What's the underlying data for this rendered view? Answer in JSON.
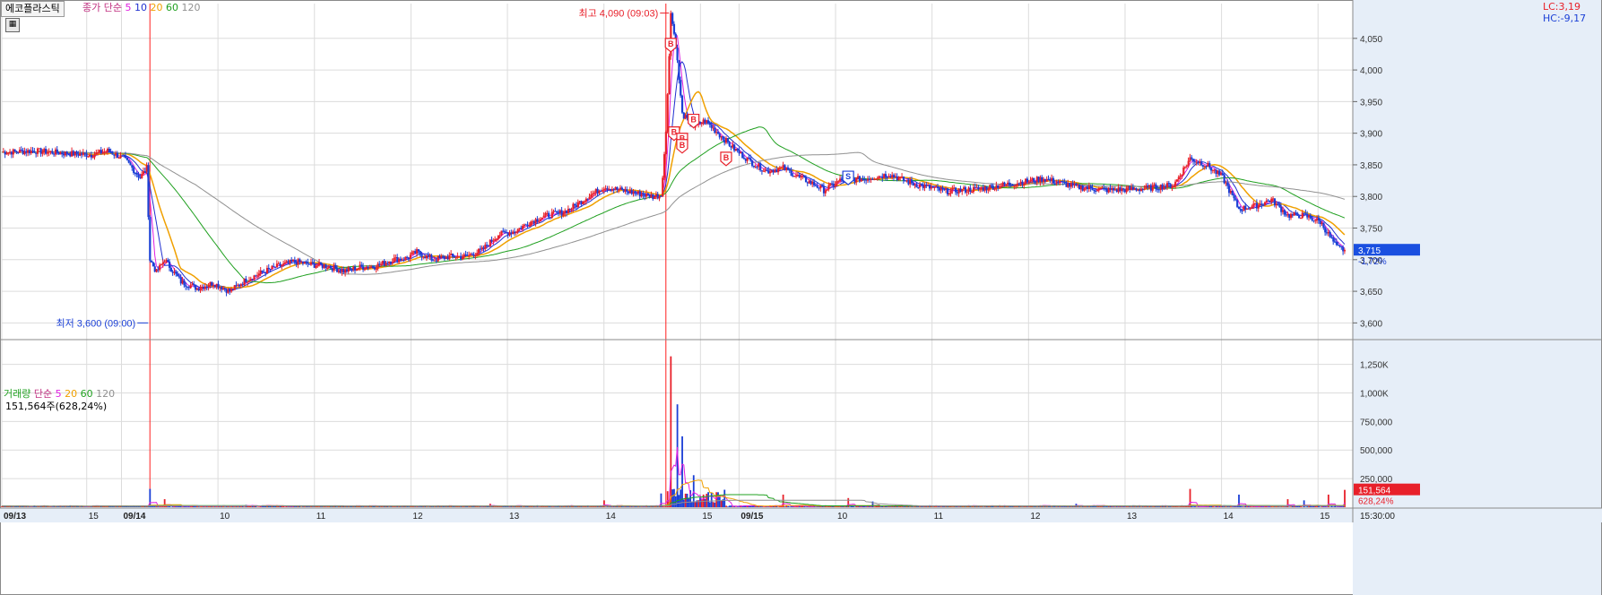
{
  "title": "에코플라스틱",
  "price_indicator": {
    "label": "종가",
    "ma_type": "단순",
    "periods": [
      "5",
      "10",
      "20",
      "60",
      "120"
    ]
  },
  "volume_indicator": {
    "label": "거래량",
    "ma_type": "단순",
    "periods": [
      "5",
      "20",
      "60",
      "120"
    ],
    "current": "151,564주(628,24%)"
  },
  "corner": {
    "lc": "LC:3,19",
    "hc": "HC:-9,17"
  },
  "colors": {
    "up": "#e8202a",
    "down": "#1a3fd6",
    "ma5": "#e020e0",
    "ma10": "#2030d0",
    "ma20": "#f0a000",
    "ma60": "#20a020",
    "ma120": "#909090",
    "grid": "#dcdcdc",
    "axis_bg": "#e6eef8"
  },
  "annotations": {
    "high": {
      "text": "최고 4,090 (09:03)",
      "value": 4090
    },
    "low": {
      "text": "최저 3,600 (09:00)",
      "value": 3600
    }
  },
  "current_price": {
    "price": "3,715",
    "change": "-1,72%",
    "value": 3715
  },
  "current_volume": {
    "volume": "151,564",
    "ratio": "628,24%",
    "value": 151564
  },
  "signals": [
    "B",
    "B",
    "B",
    "B",
    "B",
    "B",
    "S"
  ],
  "chart_data": {
    "type": "line",
    "price_axis": {
      "ticks": [
        "4,050",
        "4,000",
        "3,950",
        "3,900",
        "3,850",
        "3,800",
        "3,750",
        "3,700",
        "3,650",
        "3,600"
      ],
      "range": [
        3575,
        4105
      ]
    },
    "volume_axis": {
      "ticks": [
        "1,250K",
        "1,000K",
        "750,000",
        "500,000",
        "250,000"
      ],
      "range": [
        0,
        1380000
      ]
    },
    "time_axis": [
      "09/13",
      "15",
      "09/14",
      "10",
      "11",
      "12",
      "13",
      "14",
      "15",
      "09/15",
      "10",
      "11",
      "12",
      "13",
      "14",
      "15",
      "15:30:00"
    ],
    "price_path": [
      [
        0,
        3870
      ],
      [
        20,
        3872
      ],
      [
        40,
        3868
      ],
      [
        55,
        3866
      ],
      [
        65,
        3872
      ],
      [
        75,
        3860
      ],
      [
        80,
        3845
      ],
      [
        85,
        3830
      ],
      [
        89,
        3845
      ],
      [
        91,
        3700
      ],
      [
        95,
        3680
      ],
      [
        100,
        3700
      ],
      [
        110,
        3665
      ],
      [
        120,
        3655
      ],
      [
        130,
        3663
      ],
      [
        140,
        3650
      ],
      [
        150,
        3668
      ],
      [
        160,
        3680
      ],
      [
        170,
        3690
      ],
      [
        180,
        3697
      ],
      [
        190,
        3692
      ],
      [
        200,
        3690
      ],
      [
        210,
        3682
      ],
      [
        220,
        3688
      ],
      [
        230,
        3690
      ],
      [
        240,
        3700
      ],
      [
        248,
        3702
      ],
      [
        255,
        3712
      ],
      [
        265,
        3700
      ],
      [
        275,
        3705
      ],
      [
        285,
        3705
      ],
      [
        295,
        3715
      ],
      [
        305,
        3740
      ],
      [
        315,
        3745
      ],
      [
        325,
        3760
      ],
      [
        335,
        3770
      ],
      [
        345,
        3775
      ],
      [
        352,
        3785
      ],
      [
        360,
        3800
      ],
      [
        370,
        3815
      ],
      [
        380,
        3810
      ],
      [
        390,
        3805
      ],
      [
        400,
        3800
      ],
      [
        405,
        3802
      ],
      [
        408,
        3900
      ],
      [
        411,
        4090
      ],
      [
        414,
        4040
      ],
      [
        418,
        3930
      ],
      [
        425,
        3910
      ],
      [
        432,
        3920
      ],
      [
        440,
        3900
      ],
      [
        450,
        3875
      ],
      [
        460,
        3855
      ],
      [
        470,
        3840
      ],
      [
        480,
        3845
      ],
      [
        490,
        3830
      ],
      [
        500,
        3818
      ],
      [
        505,
        3810
      ],
      [
        515,
        3825
      ],
      [
        530,
        3828
      ],
      [
        545,
        3835
      ],
      [
        560,
        3820
      ],
      [
        580,
        3808
      ],
      [
        600,
        3812
      ],
      [
        620,
        3820
      ],
      [
        640,
        3828
      ],
      [
        660,
        3815
      ],
      [
        680,
        3810
      ],
      [
        700,
        3812
      ],
      [
        720,
        3818
      ],
      [
        730,
        3860
      ],
      [
        740,
        3850
      ],
      [
        750,
        3830
      ],
      [
        760,
        3780
      ],
      [
        770,
        3785
      ],
      [
        780,
        3795
      ],
      [
        790,
        3770
      ],
      [
        800,
        3770
      ],
      [
        810,
        3760
      ],
      [
        815,
        3740
      ],
      [
        820,
        3720
      ],
      [
        825,
        3715
      ]
    ],
    "series": [
      {
        "name": "종가",
        "type": "candle"
      },
      {
        "name": "5"
      },
      {
        "name": "10"
      },
      {
        "name": "20"
      },
      {
        "name": "60"
      },
      {
        "name": "120"
      }
    ],
    "volume_series": [
      {
        "name": "거래량"
      }
    ],
    "volume_spikes": [
      [
        91,
        160000
      ],
      [
        100,
        70000
      ],
      [
        150,
        20000
      ],
      [
        300,
        30000
      ],
      [
        370,
        60000
      ],
      [
        405,
        120000
      ],
      [
        411,
        1320000
      ],
      [
        415,
        900000
      ],
      [
        418,
        620000
      ],
      [
        425,
        280000
      ],
      [
        440,
        60000
      ],
      [
        480,
        110000
      ],
      [
        520,
        80000
      ],
      [
        535,
        50000
      ],
      [
        660,
        30000
      ],
      [
        730,
        160000
      ],
      [
        760,
        110000
      ],
      [
        790,
        70000
      ],
      [
        800,
        60000
      ],
      [
        815,
        110000
      ],
      [
        825,
        151564
      ]
    ]
  }
}
